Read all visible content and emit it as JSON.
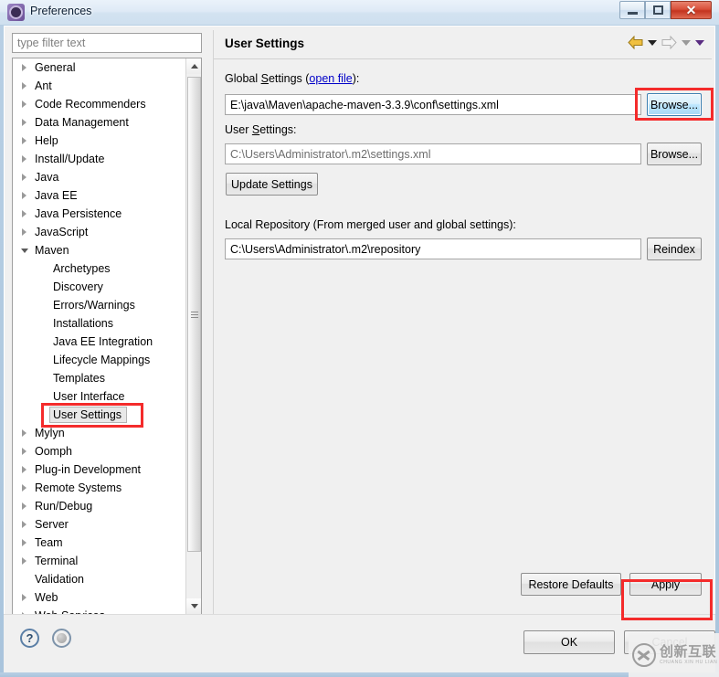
{
  "window": {
    "title": "Preferences",
    "icon": "eclipse-gear-icon",
    "controls": {
      "minimize": "minimize-icon",
      "maximize": "restore-icon",
      "close": "✕"
    }
  },
  "sidebar": {
    "filter": {
      "value": "",
      "placeholder": "type filter text"
    },
    "items": [
      {
        "label": "General",
        "level": 0,
        "expandable": true,
        "expanded": false,
        "selected": false
      },
      {
        "label": "Ant",
        "level": 0,
        "expandable": true,
        "expanded": false,
        "selected": false
      },
      {
        "label": "Code Recommenders",
        "level": 0,
        "expandable": true,
        "expanded": false,
        "selected": false
      },
      {
        "label": "Data Management",
        "level": 0,
        "expandable": true,
        "expanded": false,
        "selected": false
      },
      {
        "label": "Help",
        "level": 0,
        "expandable": true,
        "expanded": false,
        "selected": false
      },
      {
        "label": "Install/Update",
        "level": 0,
        "expandable": true,
        "expanded": false,
        "selected": false
      },
      {
        "label": "Java",
        "level": 0,
        "expandable": true,
        "expanded": false,
        "selected": false
      },
      {
        "label": "Java EE",
        "level": 0,
        "expandable": true,
        "expanded": false,
        "selected": false
      },
      {
        "label": "Java Persistence",
        "level": 0,
        "expandable": true,
        "expanded": false,
        "selected": false
      },
      {
        "label": "JavaScript",
        "level": 0,
        "expandable": true,
        "expanded": false,
        "selected": false
      },
      {
        "label": "Maven",
        "level": 0,
        "expandable": true,
        "expanded": true,
        "selected": false
      },
      {
        "label": "Archetypes",
        "level": 1,
        "expandable": false,
        "expanded": false,
        "selected": false
      },
      {
        "label": "Discovery",
        "level": 1,
        "expandable": false,
        "expanded": false,
        "selected": false
      },
      {
        "label": "Errors/Warnings",
        "level": 1,
        "expandable": false,
        "expanded": false,
        "selected": false
      },
      {
        "label": "Installations",
        "level": 1,
        "expandable": false,
        "expanded": false,
        "selected": false
      },
      {
        "label": "Java EE Integration",
        "level": 1,
        "expandable": false,
        "expanded": false,
        "selected": false
      },
      {
        "label": "Lifecycle Mappings",
        "level": 1,
        "expandable": false,
        "expanded": false,
        "selected": false
      },
      {
        "label": "Templates",
        "level": 1,
        "expandable": false,
        "expanded": false,
        "selected": false
      },
      {
        "label": "User Interface",
        "level": 1,
        "expandable": false,
        "expanded": false,
        "selected": false
      },
      {
        "label": "User Settings",
        "level": 1,
        "expandable": false,
        "expanded": false,
        "selected": true
      },
      {
        "label": "Mylyn",
        "level": 0,
        "expandable": true,
        "expanded": false,
        "selected": false
      },
      {
        "label": "Oomph",
        "level": 0,
        "expandable": true,
        "expanded": false,
        "selected": false
      },
      {
        "label": "Plug-in Development",
        "level": 0,
        "expandable": true,
        "expanded": false,
        "selected": false
      },
      {
        "label": "Remote Systems",
        "level": 0,
        "expandable": true,
        "expanded": false,
        "selected": false
      },
      {
        "label": "Run/Debug",
        "level": 0,
        "expandable": true,
        "expanded": false,
        "selected": false
      },
      {
        "label": "Server",
        "level": 0,
        "expandable": true,
        "expanded": false,
        "selected": false
      },
      {
        "label": "Team",
        "level": 0,
        "expandable": true,
        "expanded": false,
        "selected": false
      },
      {
        "label": "Terminal",
        "level": 0,
        "expandable": true,
        "expanded": false,
        "selected": false
      },
      {
        "label": "Validation",
        "level": 0,
        "expandable": false,
        "expanded": false,
        "selected": false
      },
      {
        "label": "Web",
        "level": 0,
        "expandable": true,
        "expanded": false,
        "selected": false
      },
      {
        "label": "Web Services",
        "level": 0,
        "expandable": true,
        "expanded": false,
        "selected": false
      }
    ]
  },
  "page": {
    "title": "User Settings",
    "nav": {
      "back_icon": "back-arrow-icon",
      "back_menu_icon": "chevron-down-icon",
      "forward_icon": "forward-arrow-icon",
      "forward_menu_icon": "chevron-down-icon",
      "view_menu_icon": "chevron-down-icon"
    },
    "global_settings": {
      "label_prefix": "Global ",
      "label_mnemonic": "S",
      "label_rest": "ettings (",
      "link": "open file",
      "label_suffix": "):",
      "value": "E:\\java\\Maven\\apache-maven-3.3.9\\conf\\settings.xml",
      "browse_label": "Browse..."
    },
    "user_settings": {
      "label_prefix": "User ",
      "label_mnemonic": "S",
      "label_rest": "ettings:",
      "value": "C:\\Users\\Administrator\\.m2\\settings.xml",
      "browse_label": "Browse...",
      "update_label": "Update Settings"
    },
    "local_repository": {
      "label": "Local Repository (From merged user and global settings):",
      "value": "C:\\Users\\Administrator\\.m2\\repository",
      "reindex_label": "Reindex"
    },
    "restore_defaults_label": "Restore Defaults",
    "apply_label": "Apply"
  },
  "footer": {
    "help_icon": "?",
    "extra_icon": "circle-icon",
    "ok_label": "OK",
    "cancel_label": "Cancel"
  },
  "watermark": {
    "cn": "创新互联",
    "pinyin": "CHUANG XIN HU LIAN"
  },
  "colors": {
    "annotation": "#f42b2b",
    "link": "#0000c8",
    "panel_bg": "#f0f0f0",
    "title_bar": "#dfeaf6",
    "close_button": "#d9503a",
    "back_arrow": "#e8b33c"
  }
}
